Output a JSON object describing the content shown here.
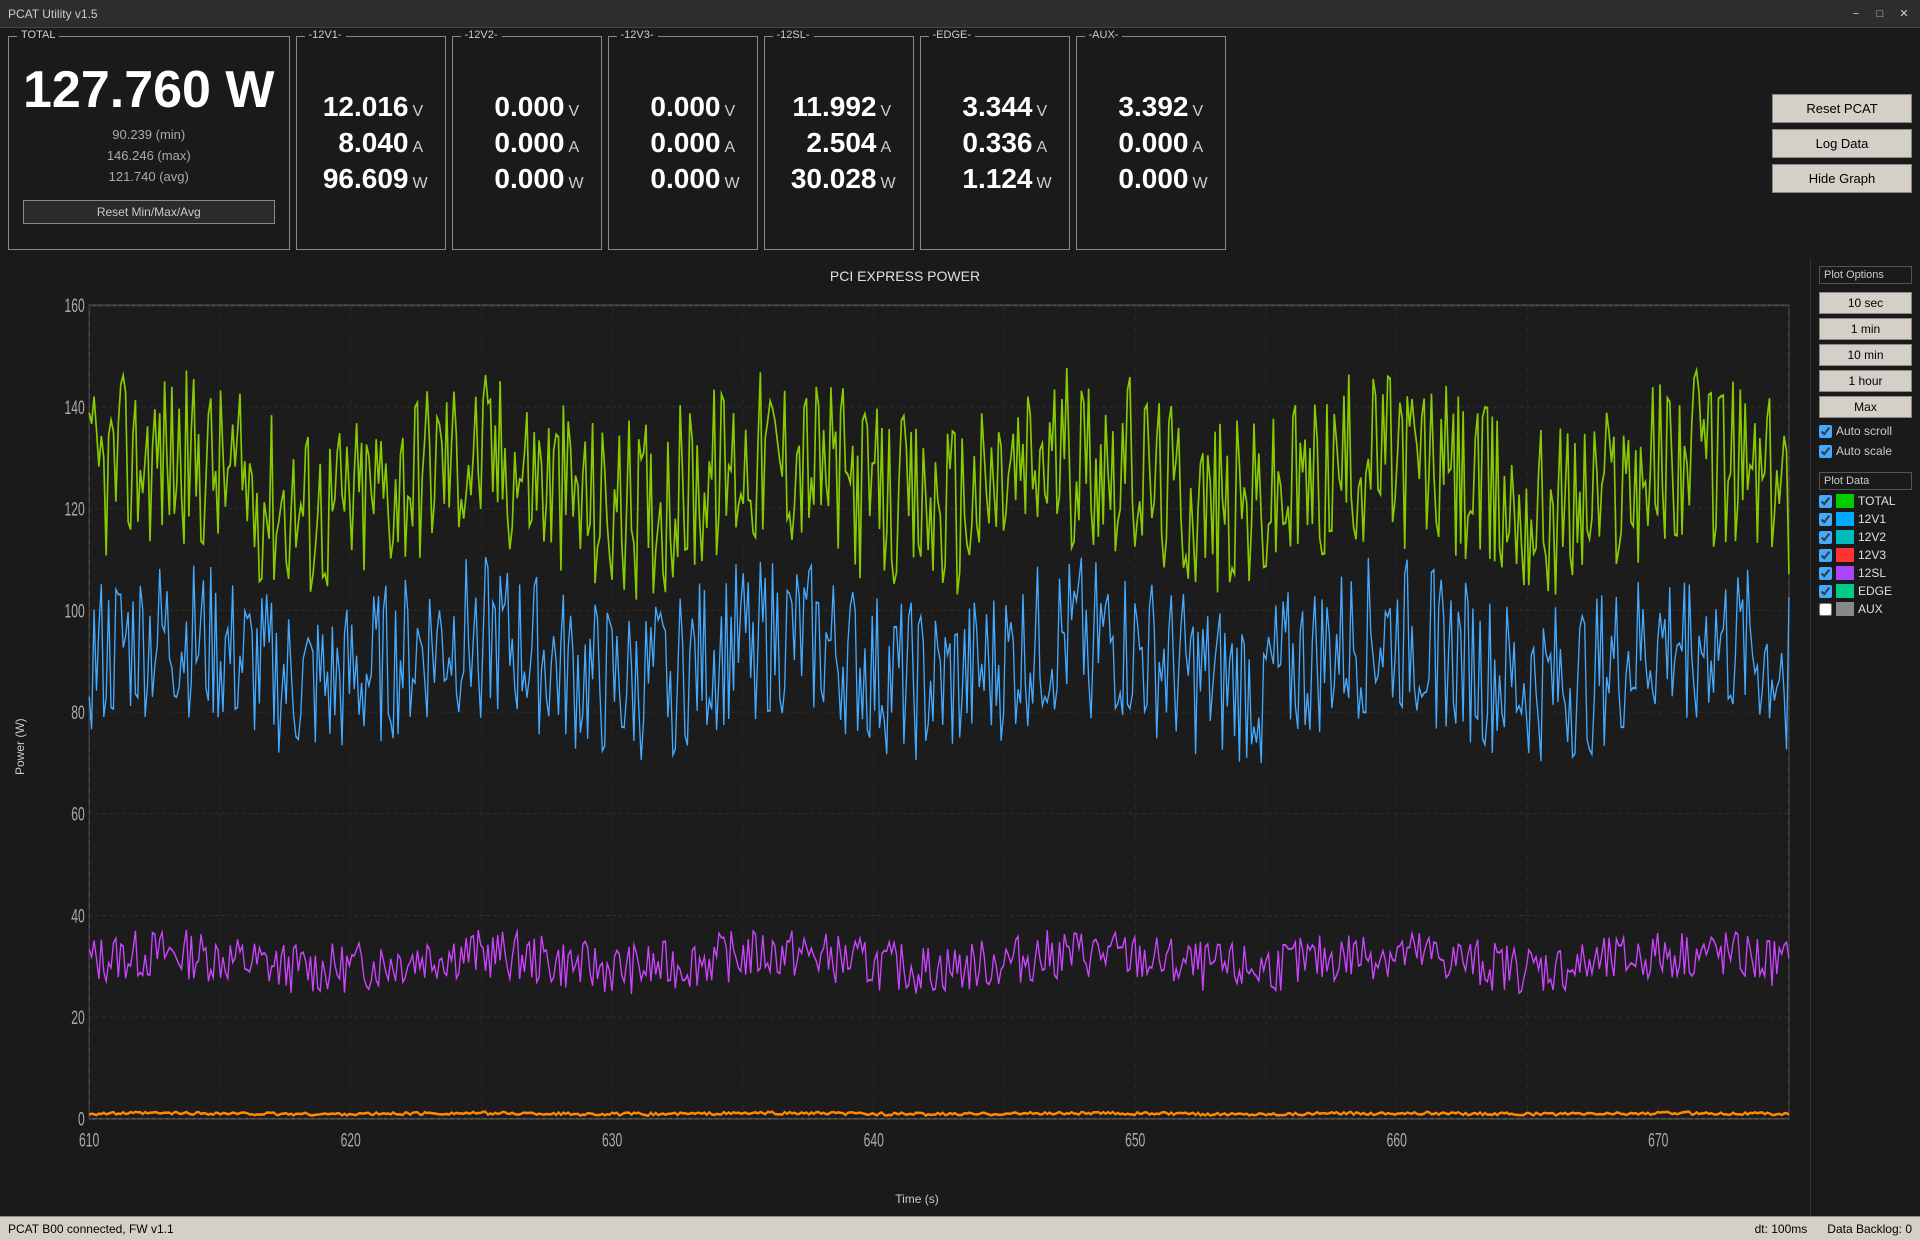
{
  "titlebar": {
    "title": "PCAT Utility v1.5",
    "minimize_label": "−",
    "maximize_label": "□",
    "close_label": "✕"
  },
  "total_panel": {
    "label": "TOTAL",
    "value": "127.760 W",
    "min": "90.239 (min)",
    "max": "146.246 (max)",
    "avg": "121.740 (avg)",
    "reset_btn": "Reset Min/Max/Avg"
  },
  "rails": [
    {
      "label": "-12V1-",
      "voltage": "12.016",
      "current": "8.040",
      "power": "96.609",
      "v_unit": "V",
      "a_unit": "A",
      "w_unit": "W"
    },
    {
      "label": "-12V2-",
      "voltage": "0.000",
      "current": "0.000",
      "power": "0.000",
      "v_unit": "V",
      "a_unit": "A",
      "w_unit": "W"
    },
    {
      "label": "-12V3-",
      "voltage": "0.000",
      "current": "0.000",
      "power": "0.000",
      "v_unit": "V",
      "a_unit": "A",
      "w_unit": "W"
    },
    {
      "label": "-12SL-",
      "voltage": "11.992",
      "current": "2.504",
      "power": "30.028",
      "v_unit": "V",
      "a_unit": "A",
      "w_unit": "W"
    },
    {
      "label": "-EDGE-",
      "voltage": "3.344",
      "current": "0.336",
      "power": "1.124",
      "v_unit": "V",
      "a_unit": "A",
      "w_unit": "W"
    },
    {
      "label": "-AUX-",
      "voltage": "3.392",
      "current": "0.000",
      "power": "0.000",
      "v_unit": "V",
      "a_unit": "A",
      "w_unit": "W"
    }
  ],
  "right_buttons": {
    "reset_pcat": "Reset PCAT",
    "log_data": "Log Data",
    "hide_graph": "Hide Graph"
  },
  "graph": {
    "title": "PCI EXPRESS POWER",
    "y_label": "Power (W)",
    "x_label": "Time (s)",
    "y_ticks": [
      "0",
      "20",
      "40",
      "60",
      "80",
      "100",
      "120",
      "140",
      "160"
    ],
    "x_ticks": [
      "610",
      "620",
      "630",
      "640",
      "650",
      "660",
      "670"
    ],
    "y_max": 160,
    "y_min": 0
  },
  "plot_options": {
    "section_label": "Plot Options",
    "buttons": [
      "10 sec",
      "1 min",
      "10 min",
      "1 hour",
      "Max"
    ],
    "auto_scroll_checked": true,
    "auto_scale_checked": true,
    "auto_scroll_label": "Auto scroll",
    "auto_scale_label": "Auto scale"
  },
  "plot_data": {
    "section_label": "Plot Data",
    "items": [
      {
        "label": "TOTAL",
        "color": "#00cc00",
        "checked": true
      },
      {
        "label": "12V1",
        "color": "#00aaff",
        "checked": true
      },
      {
        "label": "12V2",
        "color": "#00bbbb",
        "checked": true
      },
      {
        "label": "12V3",
        "color": "#ff3333",
        "checked": true
      },
      {
        "label": "12SL",
        "color": "#aa44ff",
        "checked": true
      },
      {
        "label": "EDGE",
        "color": "#00cc88",
        "checked": true
      },
      {
        "label": "AUX",
        "color": "#888888",
        "checked": false
      }
    ]
  },
  "statusbar": {
    "connection": "PCAT B00 connected, FW v1.1",
    "dt": "dt: 100ms",
    "backlog": "Data Backlog: 0"
  }
}
